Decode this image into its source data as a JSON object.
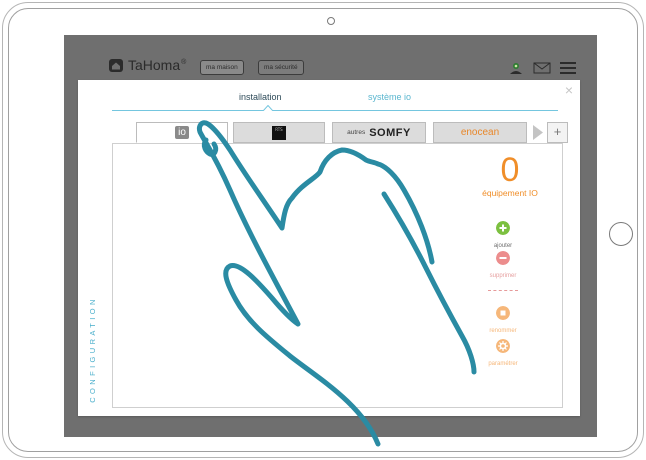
{
  "app": {
    "logo_text": "TaHoma",
    "logo_mark": "®",
    "nav_pills": [
      "ma maison",
      "ma sécurité"
    ]
  },
  "dialog": {
    "close_icon": "×",
    "tabs": [
      "installation",
      "système io"
    ],
    "side_label": "CONFIGURATION",
    "protocol_tabs": {
      "io": "io",
      "rts": "RTS",
      "autres_prefix": "autres",
      "somfy": "SOMFY",
      "enocean": "enocean",
      "plus": "+"
    },
    "counter": {
      "value": "0",
      "label": "équipement  IO"
    },
    "actions": [
      {
        "label": "ajouter",
        "icon": "add-icon",
        "color": "#7cc040"
      },
      {
        "label": "supprimer",
        "icon": "remove-icon",
        "color": "#ec8d8d"
      },
      {
        "label": "renommer",
        "icon": "rename-icon",
        "color": "#f6b77a"
      },
      {
        "label": "paramétrer",
        "icon": "settings-icon",
        "color": "#f6b77a"
      }
    ]
  },
  "colors": {
    "accent_blue": "#4aaecc",
    "orange": "#f08e29",
    "green": "#7cc040",
    "gesture_stroke": "#2a8ba3"
  }
}
